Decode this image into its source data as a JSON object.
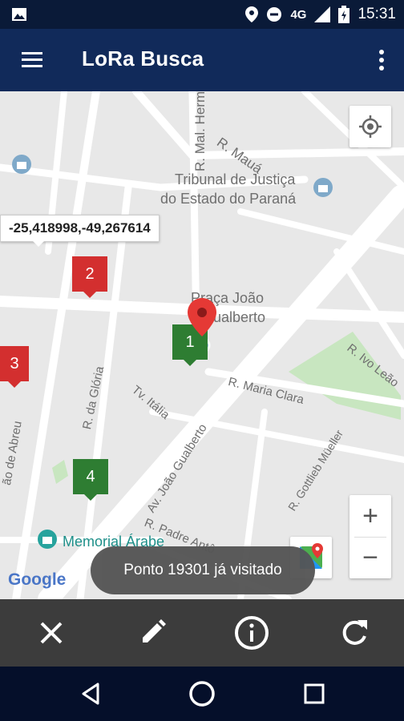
{
  "status_bar": {
    "network": "4G",
    "time": "15:31"
  },
  "app_bar": {
    "title": "LoRa Busca"
  },
  "map": {
    "coordinate_tooltip": "-25,418998,-49,267614",
    "street_labels": {
      "mal_hermes": "R. Mal. Hermes",
      "maua": "R. Mauá",
      "tribunal_1": "Tribunal de Justiça",
      "tribunal_2": "do Estado do Paraná",
      "praca_1": "Praça João",
      "praca_2": "Gualberto",
      "ivo_leao": "R. Ivo Leão",
      "maria_clara": "R. Maria Clara",
      "italia": "Tv. Itália",
      "gloria": "R. da Glória",
      "abreu": "ão de Abreu",
      "joao_gualberto": "Av. João Gualberto",
      "gottlieb": "R. Gottlieb Müeller",
      "padre_anto": "R. Padre Antô",
      "memorial": "Memorial Árabe",
      "google": "Google"
    },
    "markers": [
      {
        "label": "2",
        "color": "#d32f2f"
      },
      {
        "label": "3",
        "color": "#d32f2f"
      },
      {
        "label": "1",
        "color": "#2e7d32"
      },
      {
        "label": "4",
        "color": "#2e7d32"
      }
    ],
    "zoom_in": "+",
    "zoom_out": "−"
  },
  "toast": {
    "message": "Ponto 19301 já visitado"
  },
  "bottom_bar": {
    "icons": [
      "close-icon",
      "edit-icon",
      "info-icon",
      "refresh-icon"
    ]
  },
  "nav_bar": {
    "icons": [
      "back-icon",
      "home-icon",
      "recents-icon"
    ]
  },
  "colors": {
    "app_bar": "#112a5a",
    "status_bar": "#0a1a38",
    "red_marker": "#d32f2f",
    "green_marker": "#2e7d32",
    "bottom_bar": "#3c3c3c"
  }
}
